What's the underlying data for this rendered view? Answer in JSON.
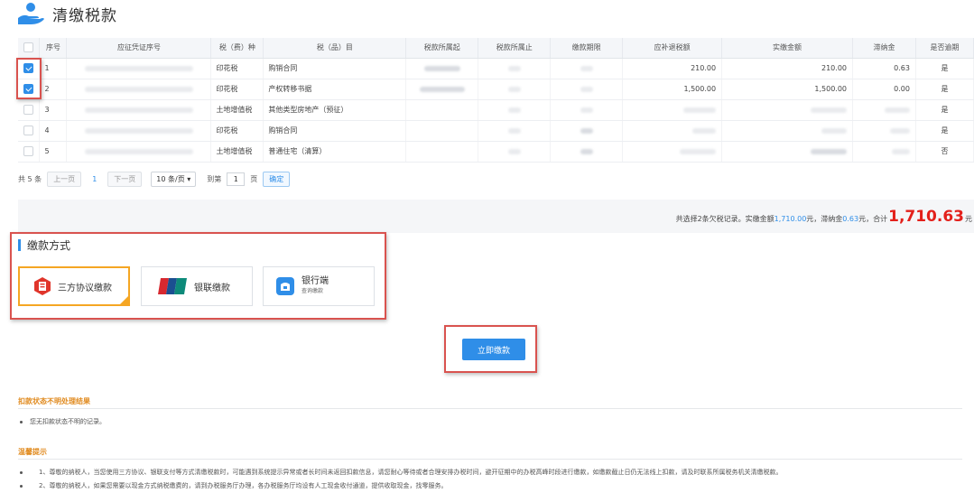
{
  "header": {
    "title": "清缴税款",
    "logo_icon": "hand-holding-person-icon"
  },
  "table": {
    "columns": [
      "序号",
      "应征凭证序号",
      "税（费）种",
      "税（品）目",
      "税款所属起",
      "税款所属止",
      "缴款期限",
      "应补退税额",
      "实缴金额",
      "滞纳金",
      "是否逾期"
    ],
    "rows": [
      {
        "checked": true,
        "no": "1",
        "tax_type": "印花税",
        "item": "购销合同",
        "due": "210.00",
        "paid": "210.00",
        "late_fee": "0.63",
        "overdue": "是"
      },
      {
        "checked": true,
        "no": "2",
        "tax_type": "印花税",
        "item": "产权转移书据",
        "due": "1,500.00",
        "paid": "1,500.00",
        "late_fee": "0.00",
        "overdue": "是"
      },
      {
        "checked": false,
        "no": "3",
        "tax_type": "土地增值税",
        "item": "其他类型房地产（预征）",
        "due": "",
        "paid": "",
        "late_fee": "",
        "overdue": "是"
      },
      {
        "checked": false,
        "no": "4",
        "tax_type": "印花税",
        "item": "购销合同",
        "due": "",
        "paid": "",
        "late_fee": "",
        "overdue": "是"
      },
      {
        "checked": false,
        "no": "5",
        "tax_type": "土地增值税",
        "item": "普通住宅（清算）",
        "due": "",
        "paid": "",
        "late_fee": "",
        "overdue": "否"
      }
    ]
  },
  "pager": {
    "total": "共 5 条",
    "prev": "上一页",
    "page": "1",
    "next": "下一页",
    "page_size": "10 条/页 ▾",
    "goto_label": "到第",
    "goto_value": "1",
    "page_unit": "页",
    "confirm": "确定"
  },
  "summary": {
    "prefix": "共选择2条欠税记录。实缴金额",
    "paid_amount": "1,710.00",
    "mid1": "元，滞纳金",
    "late_fee": "0.63",
    "mid2": "元，合计",
    "total": "1,710.63",
    "suffix": "元"
  },
  "payment": {
    "title": "缴款方式",
    "options": [
      {
        "label": "三方协议缴款",
        "icon": "tripartite-agreement-icon",
        "selected": true
      },
      {
        "label": "银联缴款",
        "icon": "unionpay-icon",
        "selected": false
      },
      {
        "label": "银行端",
        "sublabel": "查询缴款",
        "icon": "bank-wallet-icon",
        "selected": false
      }
    ],
    "pay_button": "立即缴款"
  },
  "deduct_status": {
    "title": "扣款状态不明处理结果",
    "message": "您无扣款状态不明的记录。"
  },
  "tips": {
    "title": "温馨提示",
    "items": [
      "1、尊敬的纳税人，当您使用三方协议、银联支付等方式清缴税款时，可能遇到系统提示异常或者长时间未返回扣款信息，请您耐心等待或者合理安排办税时间，避开征期中的办税高峰时段进行缴款，如缴款截止日仍无法线上扣款，请及时联系所属税务机关清缴税款。",
      "2、尊敬的纳税人，如果您需要以现金方式纳税缴费的，请到办税服务厅办理，各办税服务厅均设有人工现金收付通道，提供收取现金，找零服务。"
    ]
  },
  "colors": {
    "accent": "#2f8ee8",
    "total_red": "#e3201b",
    "highlight_box": "#d9534f",
    "selected_card": "#f5a623",
    "section_orange": "#e08a1e"
  }
}
